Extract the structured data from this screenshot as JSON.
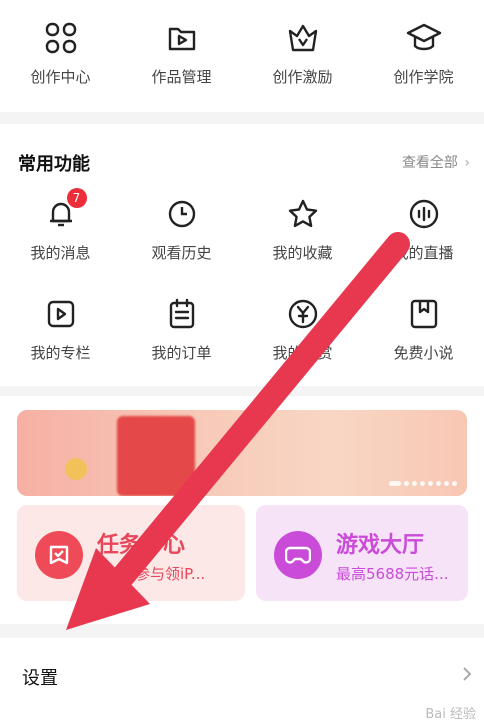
{
  "top_row": [
    {
      "label": "创作中心",
      "icon": "grid-icon"
    },
    {
      "label": "作品管理",
      "icon": "video-folder-icon"
    },
    {
      "label": "创作激励",
      "icon": "crown-icon"
    },
    {
      "label": "创作学院",
      "icon": "graduation-cap-icon"
    }
  ],
  "common": {
    "title": "常用功能",
    "see_all": "查看全部",
    "row1": [
      {
        "label": "我的消息",
        "icon": "bell-icon",
        "badge": "7"
      },
      {
        "label": "观看历史",
        "icon": "clock-icon"
      },
      {
        "label": "我的收藏",
        "icon": "star-icon"
      },
      {
        "label": "我的直播",
        "icon": "live-icon"
      }
    ],
    "row2": [
      {
        "label": "我的专栏",
        "icon": "play-square-icon"
      },
      {
        "label": "我的订单",
        "icon": "order-list-icon"
      },
      {
        "label": "我的赞赏",
        "icon": "yen-coin-icon"
      },
      {
        "label": "免费小说",
        "icon": "book-icon"
      }
    ]
  },
  "tiles": {
    "task": {
      "title": "任务中心",
      "subtitle": "参与领iP..."
    },
    "game": {
      "title": "游戏大厅",
      "subtitle": "最高5688元话..."
    }
  },
  "settings": {
    "label": "设置"
  },
  "watermark": "Bai 经验",
  "colors": {
    "accent_red": "#e8465a",
    "game_purple": "#c94bd8",
    "arrow": "#e8384f"
  }
}
